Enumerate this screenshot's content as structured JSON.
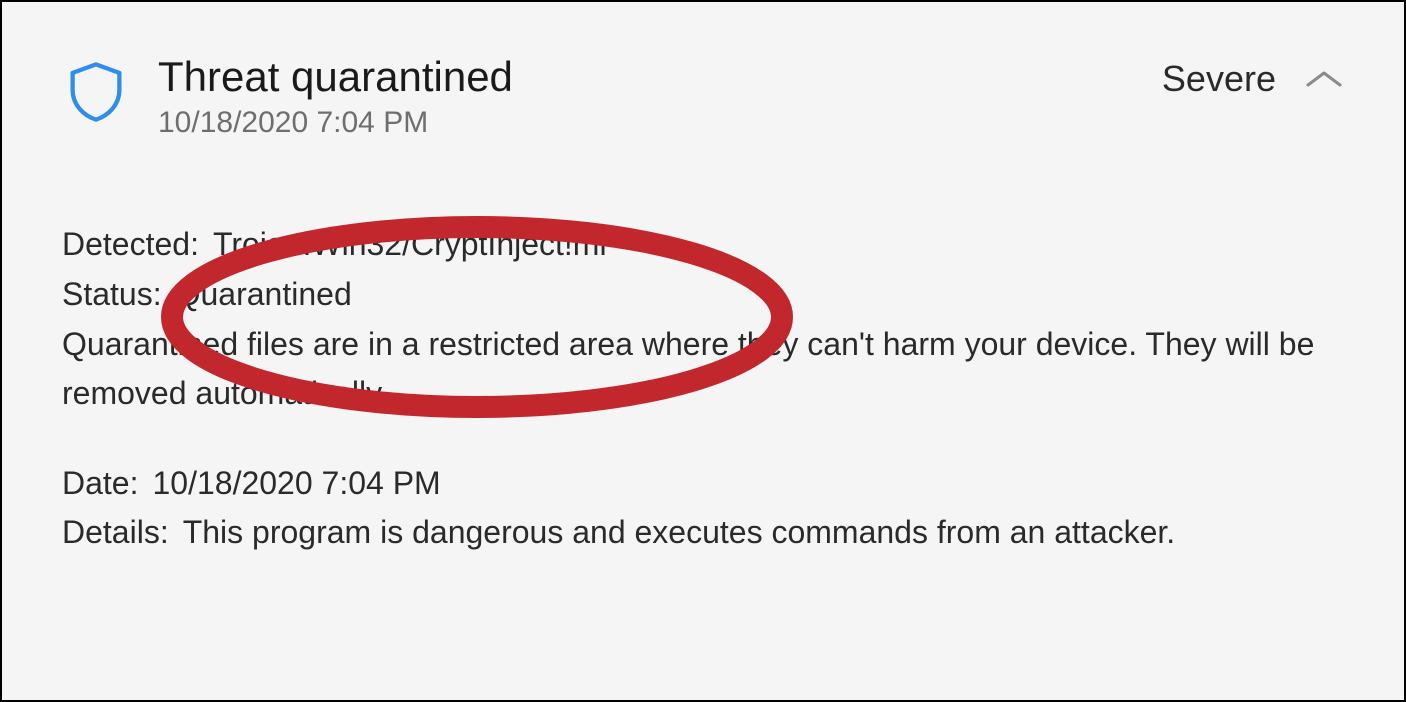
{
  "header": {
    "title": "Threat quarantined",
    "timestamp": "10/18/2020 7:04 PM",
    "severity": "Severe"
  },
  "detected": {
    "label": "Detected:",
    "value": "Trojan:Win32/CryptInject!ml"
  },
  "status": {
    "label": "Status:",
    "value": "Quarantined"
  },
  "description": "Quarantined files are in a restricted area where they can't harm your device. They will be removed automatically.",
  "date": {
    "label": "Date:",
    "value": "10/18/2020 7:04 PM"
  },
  "details": {
    "label": "Details:",
    "value": "This program is dangerous and executes commands from an attacker."
  },
  "colors": {
    "shield_stroke": "#2f8deb",
    "annotation": "#c1272d"
  }
}
